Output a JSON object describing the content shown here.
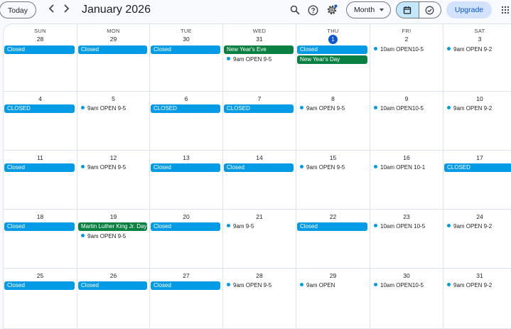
{
  "header": {
    "today_label": "Today",
    "prev_icon": "chevron-left-icon",
    "next_icon": "chevron-right-icon",
    "title": "January 2026",
    "view_label": "Month",
    "upgrade_label": "Upgrade"
  },
  "colors": {
    "accent": "#0b57d0",
    "event_blue": "#039be5",
    "event_green": "#0b8043",
    "toggle_active": "#c2e7ff"
  },
  "weekdays": [
    "SUN",
    "MON",
    "TUE",
    "WED",
    "THU",
    "FRI",
    "SAT"
  ],
  "weeks": [
    [
      {
        "day": "28",
        "events": [
          {
            "type": "chip",
            "color": "blue",
            "label": "Closed"
          }
        ]
      },
      {
        "day": "29",
        "events": [
          {
            "type": "chip",
            "color": "blue",
            "label": "Closed"
          }
        ]
      },
      {
        "day": "30",
        "events": [
          {
            "type": "chip",
            "color": "blue",
            "label": "Closed"
          }
        ]
      },
      {
        "day": "31",
        "events": [
          {
            "type": "chip",
            "color": "green",
            "label": "New Year's Eve"
          },
          {
            "type": "timed",
            "label": "9am OPEN 9-5"
          }
        ]
      },
      {
        "day": "1",
        "today": true,
        "events": [
          {
            "type": "chip",
            "color": "blue",
            "label": "Closed"
          },
          {
            "type": "chip",
            "color": "green",
            "label": "New Year's Day"
          }
        ]
      },
      {
        "day": "2",
        "events": [
          {
            "type": "timed",
            "label": "10am OPEN10-5"
          }
        ]
      },
      {
        "day": "3",
        "events": [
          {
            "type": "timed",
            "label": "9am OPEN 9-2"
          }
        ]
      }
    ],
    [
      {
        "day": "4",
        "events": [
          {
            "type": "chip",
            "color": "blue",
            "label": "CLOSED"
          }
        ]
      },
      {
        "day": "5",
        "events": [
          {
            "type": "timed",
            "label": "9am OPEN 9-5"
          }
        ]
      },
      {
        "day": "6",
        "events": [
          {
            "type": "chip",
            "color": "blue",
            "label": "CLOSED"
          }
        ]
      },
      {
        "day": "7",
        "events": [
          {
            "type": "chip",
            "color": "blue",
            "label": "CLOSED"
          }
        ]
      },
      {
        "day": "8",
        "events": [
          {
            "type": "timed",
            "label": "9am OPEN 9-5"
          }
        ]
      },
      {
        "day": "9",
        "events": [
          {
            "type": "timed",
            "label": "10am OPEN10-5"
          }
        ]
      },
      {
        "day": "10",
        "events": [
          {
            "type": "timed",
            "label": "9am OPEN 9-2"
          }
        ]
      }
    ],
    [
      {
        "day": "11",
        "events": [
          {
            "type": "chip",
            "color": "blue",
            "label": "Closed"
          }
        ]
      },
      {
        "day": "12",
        "events": [
          {
            "type": "timed",
            "label": "9am OPEN 9-5"
          }
        ]
      },
      {
        "day": "13",
        "events": [
          {
            "type": "chip",
            "color": "blue",
            "label": "Closed"
          }
        ]
      },
      {
        "day": "14",
        "events": [
          {
            "type": "chip",
            "color": "blue",
            "label": "Closed"
          }
        ]
      },
      {
        "day": "15",
        "events": [
          {
            "type": "timed",
            "label": "9am OPEN 9-5"
          }
        ]
      },
      {
        "day": "16",
        "events": [
          {
            "type": "timed",
            "label": "10am OPEN 10-1"
          }
        ]
      },
      {
        "day": "17",
        "events": [
          {
            "type": "chip",
            "color": "blue",
            "label": "CLOSED"
          }
        ]
      }
    ],
    [
      {
        "day": "18",
        "events": [
          {
            "type": "chip",
            "color": "blue",
            "label": "Closed"
          }
        ]
      },
      {
        "day": "19",
        "events": [
          {
            "type": "chip",
            "color": "green",
            "label": "Martin Luther King Jr. Day"
          },
          {
            "type": "timed",
            "label": "9am OPEN 9-5"
          }
        ]
      },
      {
        "day": "20",
        "events": [
          {
            "type": "chip",
            "color": "blue",
            "label": "Closed"
          }
        ]
      },
      {
        "day": "21",
        "events": [
          {
            "type": "timed",
            "label": "9am 9-5"
          }
        ]
      },
      {
        "day": "22",
        "events": [
          {
            "type": "chip",
            "color": "blue",
            "label": "Closed"
          }
        ]
      },
      {
        "day": "23",
        "events": [
          {
            "type": "timed",
            "label": "10am OPEN 10-5"
          }
        ]
      },
      {
        "day": "24",
        "events": [
          {
            "type": "timed",
            "label": "9am OPEN 9-2"
          }
        ]
      }
    ],
    [
      {
        "day": "25",
        "events": [
          {
            "type": "chip",
            "color": "blue",
            "label": "Closed"
          }
        ]
      },
      {
        "day": "26",
        "events": [
          {
            "type": "chip",
            "color": "blue",
            "label": "Closed"
          }
        ]
      },
      {
        "day": "27",
        "events": [
          {
            "type": "chip",
            "color": "blue",
            "label": "Closed"
          }
        ]
      },
      {
        "day": "28",
        "events": [
          {
            "type": "timed",
            "label": "9am OPEN 9-5"
          }
        ]
      },
      {
        "day": "29",
        "events": [
          {
            "type": "timed",
            "label": "9am OPEN"
          }
        ]
      },
      {
        "day": "30",
        "events": [
          {
            "type": "timed",
            "label": "10am OPEN10-5"
          }
        ]
      },
      {
        "day": "31",
        "events": [
          {
            "type": "timed",
            "label": "9am OPEN 9-2"
          }
        ]
      }
    ]
  ]
}
